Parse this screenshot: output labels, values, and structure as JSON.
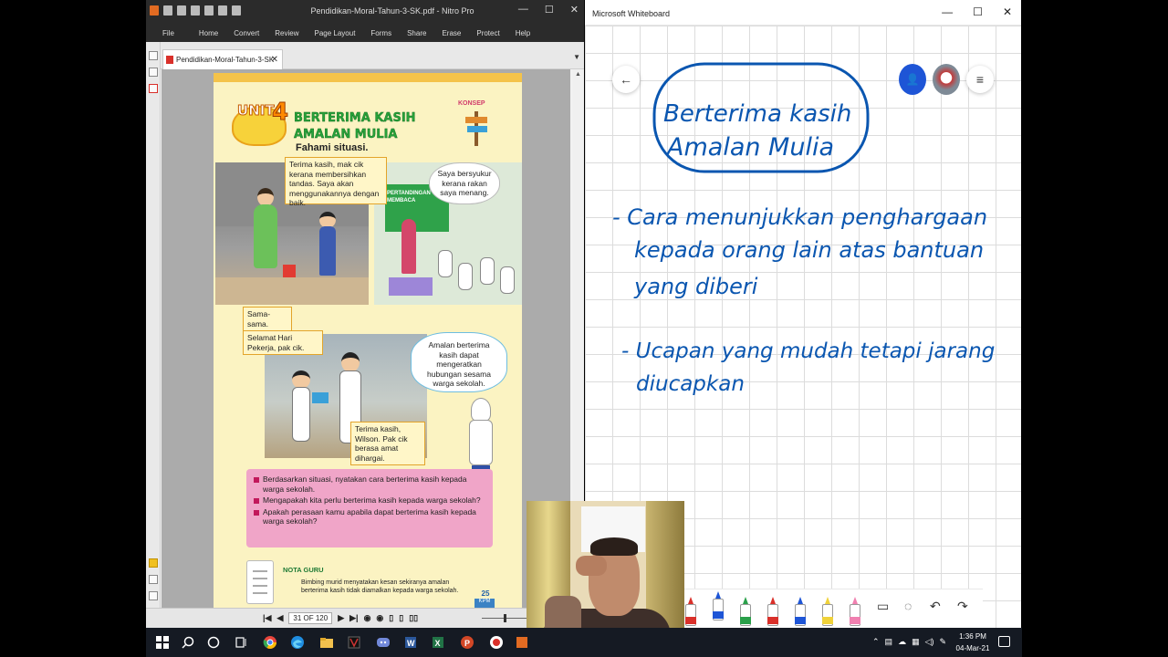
{
  "nitro": {
    "window_title": "Pendidikan-Moral-Tahun-3-SK.pdf - Nitro Pro",
    "ribbon_tabs": [
      "File",
      "Home",
      "Convert",
      "Review",
      "Page Layout",
      "Forms",
      "Share",
      "Erase",
      "Protect",
      "Help"
    ],
    "doc_tab": "Pendidikan-Moral-Tahun-3-SK",
    "page_indicator": "31 OF 120"
  },
  "page": {
    "unit_label": "UNIT",
    "unit_number": "4",
    "title_line1": "BERTERIMA KASIH",
    "title_line2": "AMALAN MULIA",
    "subtitle": "Fahami situasi.",
    "konsep": "KONSEP",
    "board_text": "PERTANDINGAN MEMBACA",
    "bubble_terima": "Terima kasih, mak cik kerana membersihkan tandas. Saya akan menggunakannya dengan baik.",
    "bubble_syukur": "Saya bersyukur kerana rakan saya menang.",
    "bubble_sama": "Sama-sama.",
    "bubble_selamat": "Selamat Hari Pekerja, pak cik.",
    "bubble_amalan": "Amalan berterima kasih dapat mengeratkan hubungan sesama warga sekolah.",
    "bubble_wilson": "Terima kasih, Wilson. Pak cik berasa amat dihargai.",
    "questions": [
      "Berdasarkan situasi, nyatakan cara berterima kasih kepada warga sekolah.",
      "Mengapakah kita perlu berterima kasih kepada warga sekolah?",
      "Apakah perasaan kamu apabila dapat berterima kasih kepada warga sekolah?"
    ],
    "nota_title": "NOTA GURU",
    "nota_text": "Bimbing murid menyatakan kesan sekiranya amalan berterima kasih tidak diamalkan kepada warga sekolah.",
    "page_number": "25",
    "kpm": "KPM"
  },
  "whiteboard": {
    "window_title": "Microsoft Whiteboard",
    "ink_box_line1": "Berterima kasih",
    "ink_box_line2": "Amalan Mulia",
    "ink_point1_line1": "- Cara menunjukkan penghargaan",
    "ink_point1_line2": "kepada orang lain atas bantuan",
    "ink_point1_line3": "yang diberi",
    "ink_point2_line1": "- Ucapan yang mudah tetapi jarang",
    "ink_point2_line2": "diucapkan",
    "ink_color": "#0a56b0",
    "pen_colors": [
      "#d9302a",
      "#1e55d6",
      "#2aa04a",
      "#d9302a",
      "#1e55d6",
      "#f0d23a",
      "#f080b0"
    ]
  },
  "taskbar": {
    "time": "1:36 PM",
    "date": "04-Mar-21"
  }
}
